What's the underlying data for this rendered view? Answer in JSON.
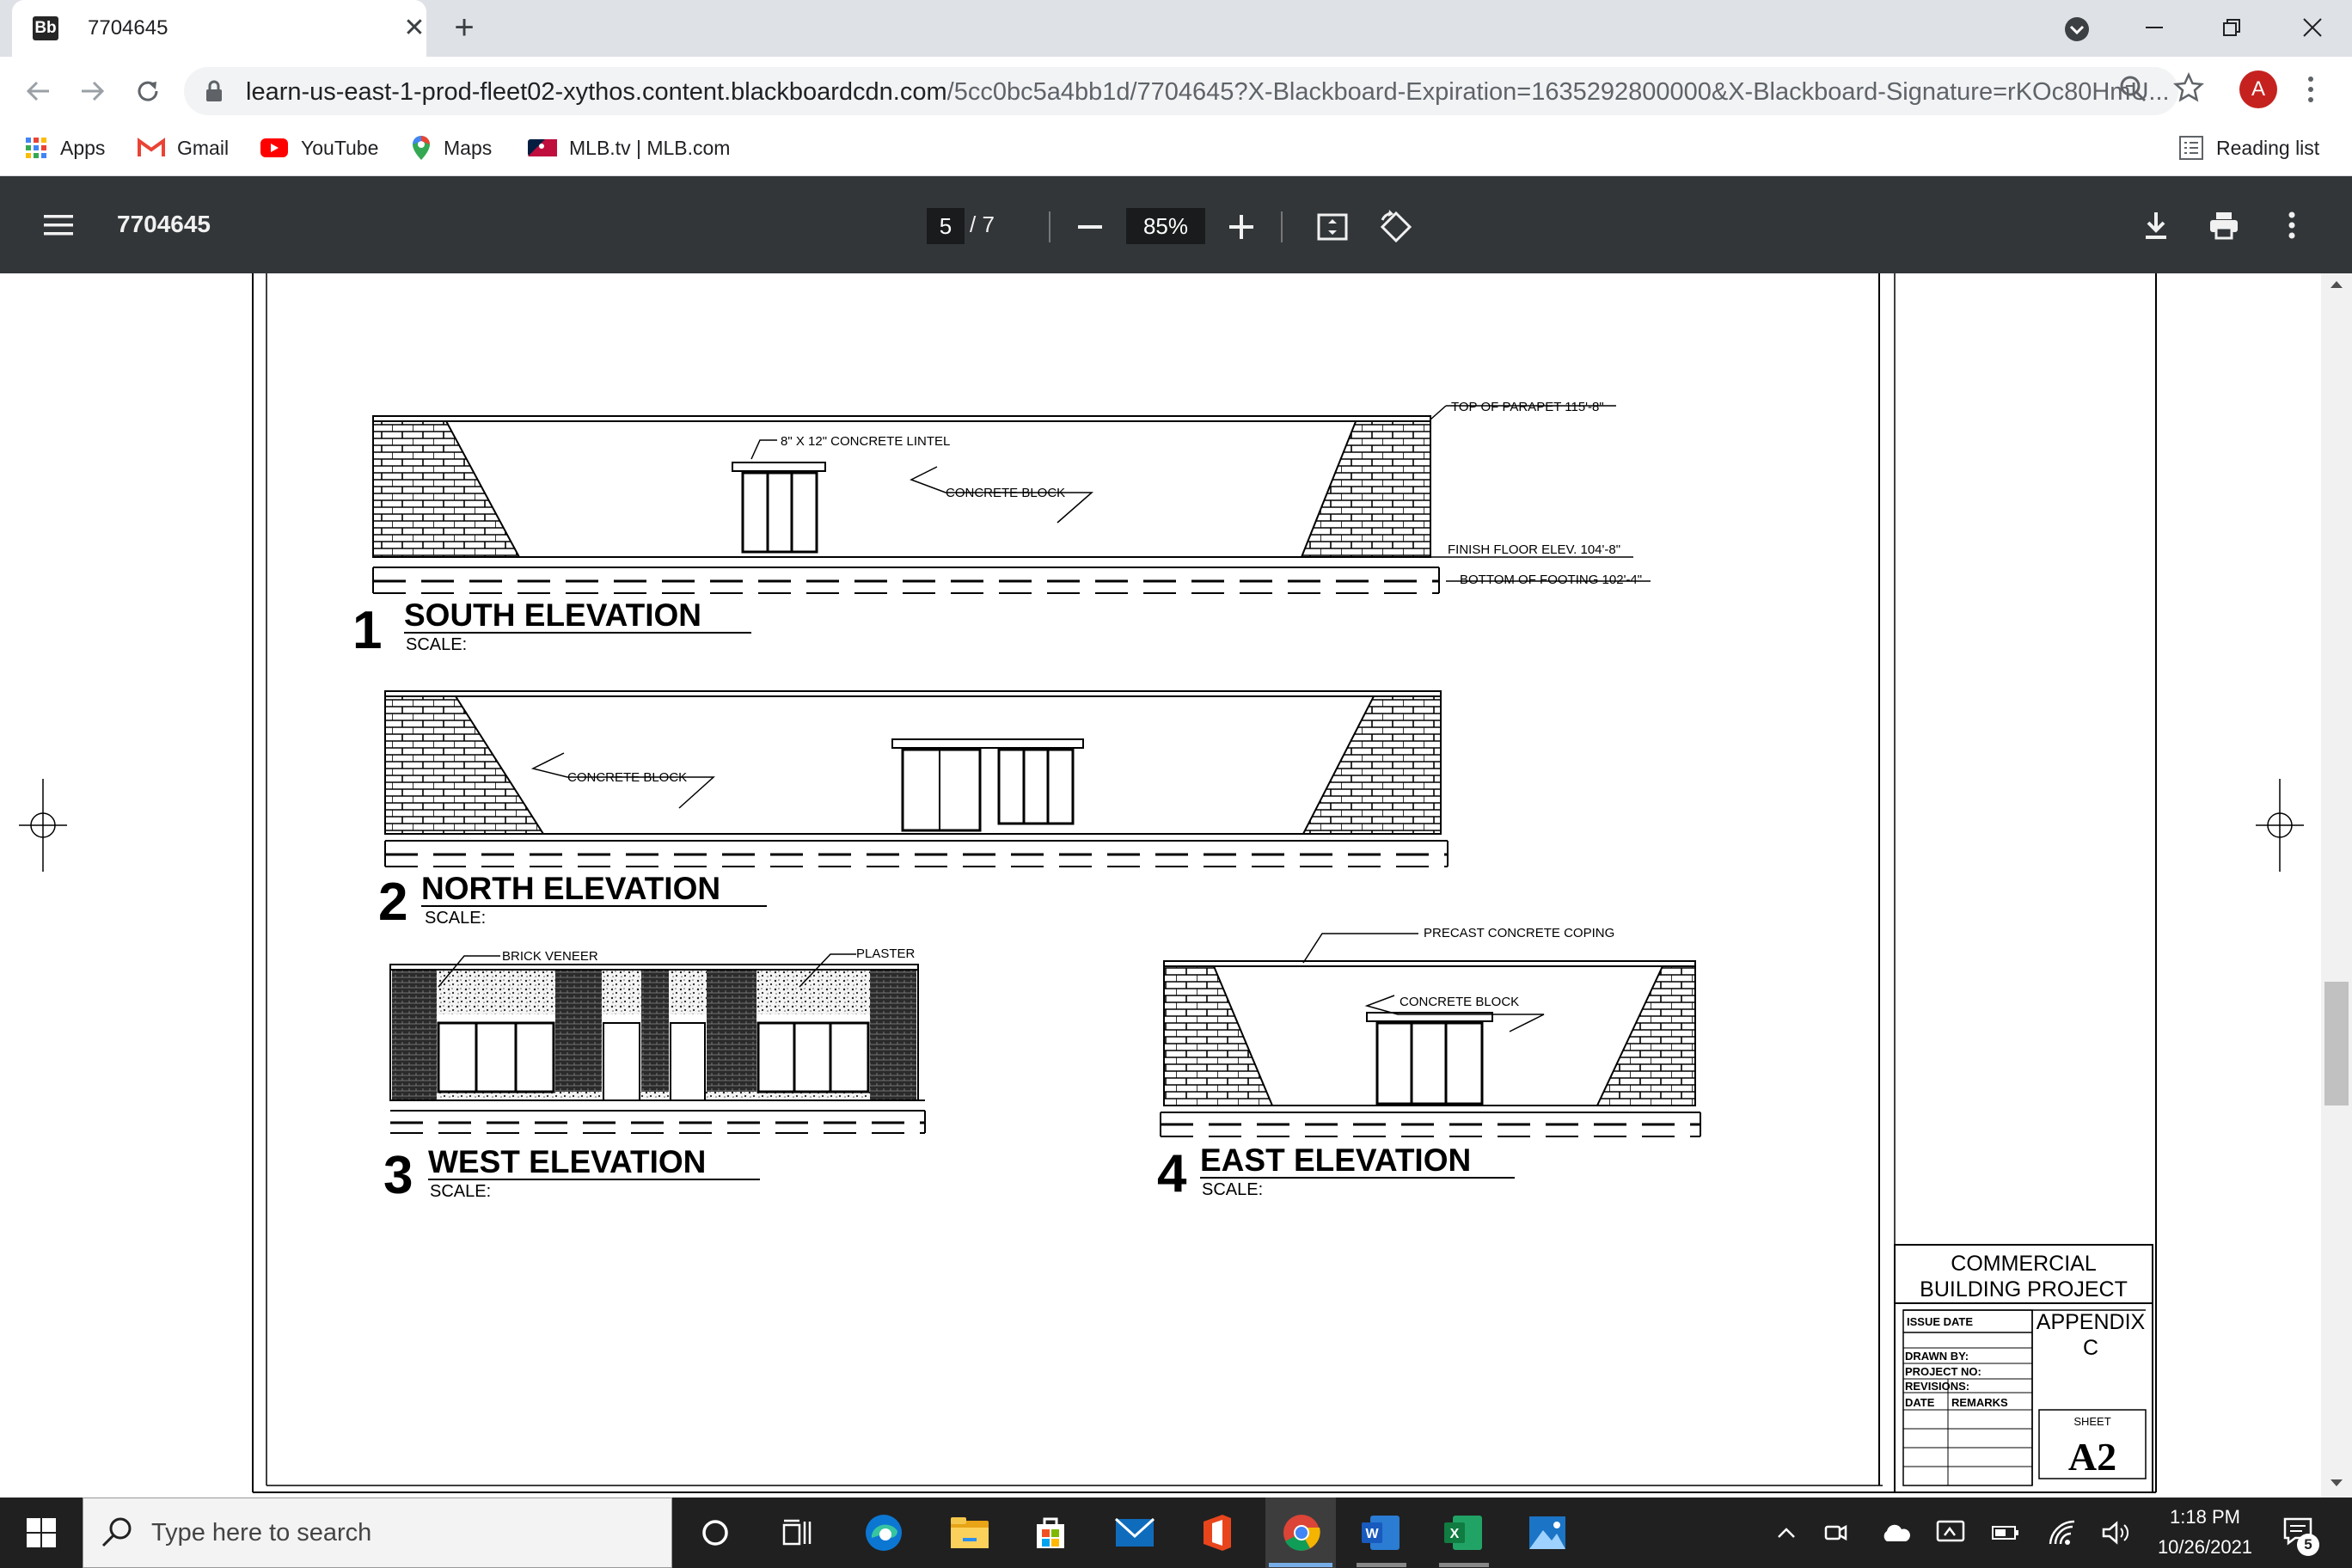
{
  "tab": {
    "favicon": "Bb",
    "title": "7704645"
  },
  "window": {
    "minimize": "—",
    "restore": "❐",
    "close": "✕"
  },
  "toolbar": {
    "url_host": "learn-us-east-1-prod-fleet02-xythos.content.blackboardcdn.com",
    "url_path": "/5cc0bc5a4bb1d/7704645?X-Blackboard-Expiration=1635292800000&X-Blackboard-Signature=rKOc80HmU...",
    "avatar": "A"
  },
  "bookmarks": [
    {
      "label": "Apps",
      "icon": "apps-grid-icon"
    },
    {
      "label": "Gmail",
      "icon": "gmail-icon"
    },
    {
      "label": "YouTube",
      "icon": "youtube-icon"
    },
    {
      "label": "Maps",
      "icon": "maps-pin-icon"
    },
    {
      "label": "MLB.tv | MLB.com",
      "icon": "mlb-icon"
    }
  ],
  "reading_list": "Reading list",
  "pdf": {
    "title": "7704645",
    "page_current": "5",
    "page_total": "/  7",
    "zoom": "85%"
  },
  "drawing": {
    "south": {
      "number": "1",
      "title": "SOUTH ELEVATION",
      "scale": "SCALE:"
    },
    "north": {
      "number": "2",
      "title": "NORTH ELEVATION",
      "scale": "SCALE:"
    },
    "west": {
      "number": "3",
      "title": "WEST ELEVATION",
      "scale": "SCALE:"
    },
    "east": {
      "number": "4",
      "title": "EAST ELEVATION",
      "scale": "SCALE:"
    },
    "labels": {
      "top_parapet": "TOP OF PARAPET 115'-8\"",
      "lintel": "8\" X 12\" CONCRETE LINTEL",
      "concrete_block": "CONCRETE BLOCK",
      "finish_floor": "FINISH FLOOR ELEV. 104'-8\"",
      "bottom_footing": "BOTTOM OF FOOTING 102'-4\"",
      "brick_veneer": "BRICK VENEER",
      "plaster": "PLASTER",
      "coping": "PRECAST CONCRETE COPING"
    },
    "titleblock": {
      "project_line1": "COMMERCIAL",
      "project_line2": "BUILDING PROJECT",
      "issue_date": "ISSUE  DATE",
      "appendix": "APPENDIX",
      "appendix_letter": "C",
      "drawn_by": "DRAWN  BY:",
      "project_no": "PROJECT  NO:",
      "revisions": "REVISIONS:",
      "date": "DATE",
      "remarks": "REMARKS",
      "sheet": "SHEET",
      "sheet_no": "A2"
    }
  },
  "taskbar": {
    "search_placeholder": "Type here to search",
    "time": "1:18 PM",
    "date": "10/26/2021",
    "notifications": "5"
  }
}
